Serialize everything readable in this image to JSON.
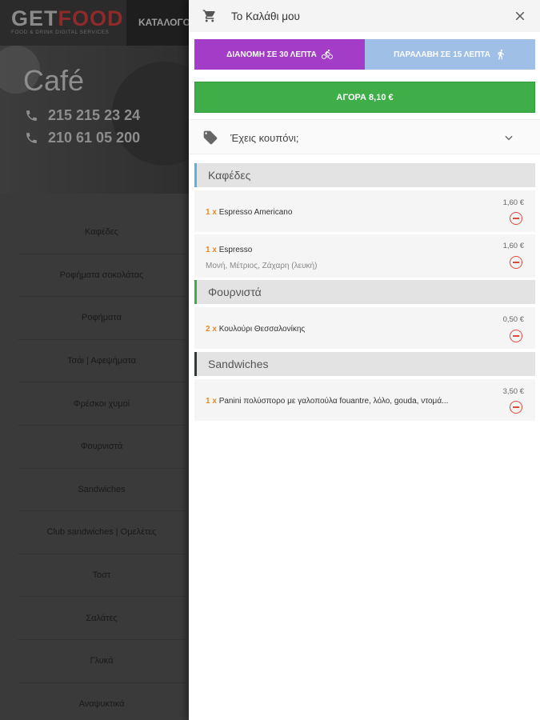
{
  "brand": {
    "logo_get": "GET",
    "logo_food": "FOOD",
    "logo_tagline": "FOOD & DRINK DIGITAL SERVICES",
    "nav_label": "ΚΑΤΑΛΟΓΟ"
  },
  "store": {
    "name": "Café",
    "phones": [
      "215 215 23 24",
      "210 61 05 200"
    ]
  },
  "menu": {
    "items": [
      "Καφέδες",
      "Ροφήματα σοκολάτας",
      "Ροφήματα",
      "Τσάι | Αφεψήματα",
      "Φρέσκοι χυμοί",
      "Φουρνιστά",
      "Sandwiches",
      "Club sandwiches | Ομελέτες",
      "Τοστ",
      "Σαλάτες",
      "Γλυκά",
      "Αναψυκτικά"
    ]
  },
  "cart": {
    "title": "Το Καλάθι μου",
    "delivery_tab": "ΔΙΑΝΟΜΗ ΣΕ 30 ΛΕΠΤΑ",
    "pickup_tab": "ΠΑΡΑΛΑΒΗ ΣΕ 15 ΛΕΠΤΑ",
    "buy_label": "ΑΓΟΡΑ 8,10 €",
    "coupon_label": "Έχεις κουπόνι;",
    "categories": [
      {
        "name": "Καφέδες",
        "items": [
          {
            "qty": "1 x",
            "name": "Espresso Americano",
            "options": "",
            "price": "1,60 €"
          },
          {
            "qty": "1 x",
            "name": "Espresso",
            "options": "Μονή, Μέτριος, Ζάχαρη (λευκή)",
            "price": "1,60 €"
          }
        ]
      },
      {
        "name": "Φουρνιστά",
        "items": [
          {
            "qty": "2 x",
            "name": "Κουλούρι Θεσσαλονίκης",
            "options": "",
            "price": "0,50 €"
          }
        ]
      },
      {
        "name": "Sandwiches",
        "items": [
          {
            "qty": "1 x",
            "name": "Panini πολύσπορο με γαλοπούλα fouantre, λόλο, gouda, ντομά...",
            "options": "",
            "price": "3,50 €"
          }
        ]
      }
    ]
  },
  "colors": {
    "delivery": "#a33dc8",
    "pickup": "#9fbfe6",
    "buy": "#3fae49",
    "qty": "#e58a1f",
    "remove": "#e04a3a"
  }
}
